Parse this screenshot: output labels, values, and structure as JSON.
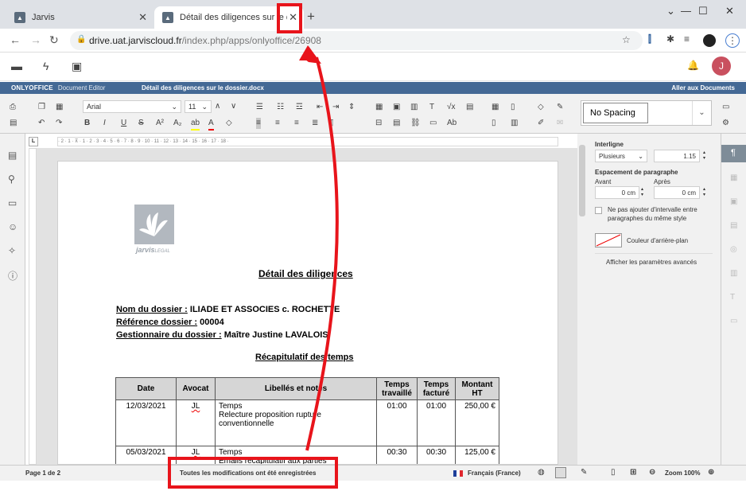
{
  "browser": {
    "tabs": [
      {
        "title": "Jarvis"
      },
      {
        "title": "Détail des diligences sur le dossier"
      }
    ],
    "url_host": "drive.uat.jarviscloud.fr",
    "url_path": "/index.php/apps/onlyoffice/26908"
  },
  "jarvis": {
    "avatar_initial": "J"
  },
  "editor": {
    "brand": "ONLYOFFICE",
    "brand_sub": "Document Editor",
    "doc_name": "Détail des diligences sur le dossier.docx",
    "go_to_docs": "Aller aux Documents",
    "font_name": "Arial",
    "font_size": "11",
    "style_name": "No Spacing"
  },
  "document": {
    "logo_text": "jarvis",
    "logo_text2": "LEGAL",
    "title": "Détail des diligences",
    "fields": [
      {
        "label": "Nom du dossier :",
        "value": " ILIADE ET ASSOCIES c. ROCHETTE"
      },
      {
        "label": "Référence dossier :",
        "value": " 00004"
      },
      {
        "label": "Gestionnaire du dossier :",
        "value": " Maître Justine LAVALOIS"
      }
    ],
    "subtitle": "Récapitulatif des temps",
    "table": {
      "headers": [
        "Date",
        "Avocat",
        "Libellés et notes",
        "Temps travaillé",
        "Temps facturé",
        "Montant HT"
      ],
      "rows": [
        {
          "date": "12/03/2021",
          "avocat": "JL",
          "note1": "Temps",
          "note2": "Relecture proposition rupture conventionnelle",
          "worked": "01:00",
          "billed": "01:00",
          "amount": "250,00 €"
        },
        {
          "date": "05/03/2021",
          "avocat": "JL",
          "note1": "Temps",
          "note2": "Emails récapitulatif aux parties",
          "worked": "00:30",
          "billed": "00:30",
          "amount": "125,00 €"
        }
      ]
    }
  },
  "panel": {
    "interligne": "Interligne",
    "line_mode": "Plusieurs",
    "line_value": "1.15",
    "spacing": "Espacement de paragraphe",
    "before": "Avant",
    "after": "Après",
    "before_val": "0 cm",
    "after_val": "0 cm",
    "no_space_1": "Ne pas ajouter d'intervalle entre",
    "no_space_2": "paragraphes du même style",
    "bg_color": "Couleur d'arrière-plan",
    "advanced": "Afficher les paramètres avancés"
  },
  "status": {
    "page": "Page 1 de 2",
    "saved": "Toutes les modifications ont été enregistrées",
    "lang": "Français (France)",
    "zoom": "Zoom 100%"
  }
}
